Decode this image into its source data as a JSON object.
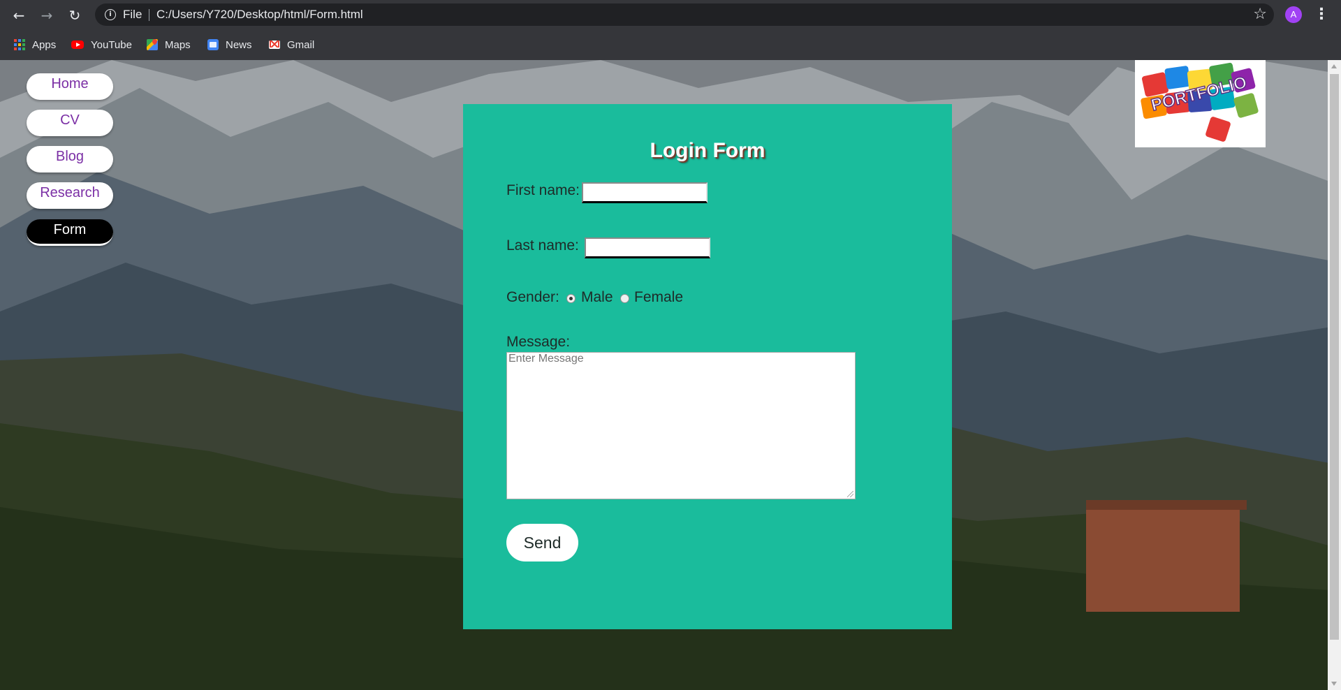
{
  "browser": {
    "scheme_label": "File",
    "url": "C:/Users/Y720/Desktop/html/Form.html",
    "avatar_letter": "A",
    "bookmarks": [
      {
        "label": "Apps",
        "icon": "apps-grid-icon"
      },
      {
        "label": "YouTube",
        "icon": "youtube-icon"
      },
      {
        "label": "Maps",
        "icon": "maps-icon"
      },
      {
        "label": "News",
        "icon": "news-icon"
      },
      {
        "label": "Gmail",
        "icon": "gmail-icon"
      }
    ]
  },
  "page": {
    "nav": [
      {
        "label": "Home",
        "active": false
      },
      {
        "label": "CV",
        "active": false
      },
      {
        "label": "Blog",
        "active": false
      },
      {
        "label": "Research",
        "active": false
      },
      {
        "label": "Form",
        "active": true
      }
    ],
    "logo_text": "PORTFOLIO",
    "form": {
      "title": "Login Form",
      "first_name_label": "First name:",
      "first_name_value": "",
      "last_name_label": "Last name:",
      "last_name_value": "",
      "gender_label": "Gender:",
      "gender_options": [
        {
          "label": "Male",
          "checked": true
        },
        {
          "label": "Female",
          "checked": false
        }
      ],
      "message_label": "Message:",
      "message_placeholder": "Enter Message",
      "send_label": "Send"
    },
    "colors": {
      "form_bg": "#1abc9c",
      "nav_text": "#7b2fa5",
      "nav_active_bg": "#000000"
    }
  }
}
